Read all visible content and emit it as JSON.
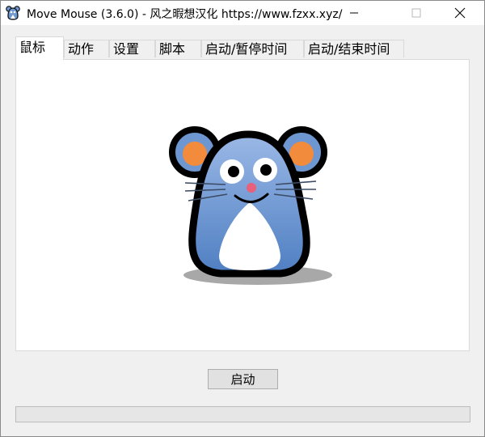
{
  "window": {
    "title": "Move Mouse (3.6.0) - 风之暇想汉化 https://www.fzxx.xyz/"
  },
  "tabs": [
    {
      "label": "鼠标",
      "active": true
    },
    {
      "label": "动作",
      "active": false
    },
    {
      "label": "设置",
      "active": false
    },
    {
      "label": "脚本",
      "active": false
    },
    {
      "label": "启动/暂停时间",
      "active": false
    },
    {
      "label": "启动/结束时间",
      "active": false
    }
  ],
  "main": {
    "mascot_icon": "mouse-mascot-icon",
    "start_label": "启动"
  },
  "progress": {
    "value_percent": 0
  },
  "colors": {
    "mascot_body": "#6e97d1",
    "mascot_ear_inner": "#f28b3c",
    "mascot_nose": "#e8607a"
  }
}
